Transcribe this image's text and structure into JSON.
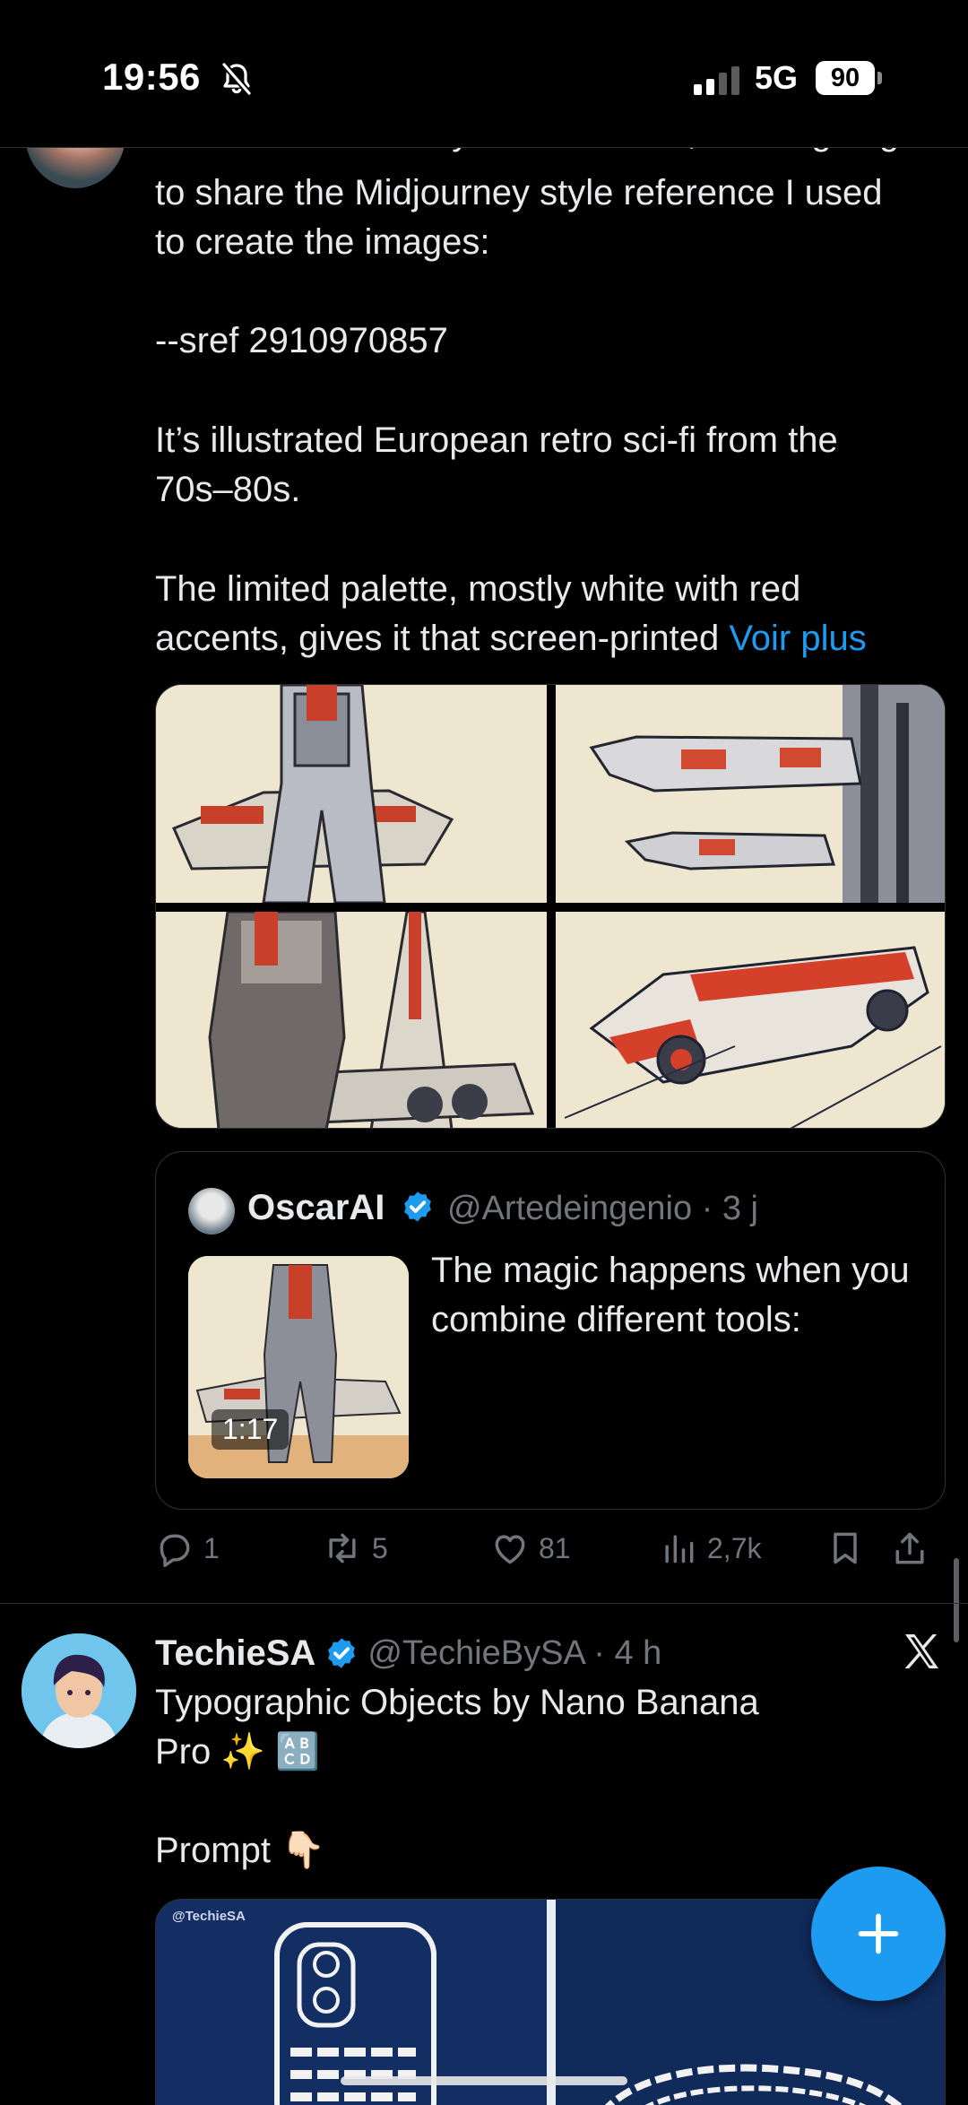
{
  "status_bar": {
    "time": "19:56",
    "network": "5G",
    "battery": "90"
  },
  "tweet1": {
    "partial_line": "This video was very well received, so I'm going",
    "lines": [
      "to share the Midjourney style reference I used",
      "to create the images:",
      "--sref 2910970857",
      "It’s illustrated European retro sci-fi from the",
      "70s–80s.",
      "The limited palette, mostly white with red",
      "accents, gives it that screen-printed"
    ],
    "more_link": "Voir plus",
    "quote": {
      "name": "OscarAI",
      "handle": "@Artedeingenio · 3 j",
      "text": "The magic happens when you combine different tools:",
      "video_duration": "1:17"
    },
    "actions": {
      "replies": "1",
      "reposts": "5",
      "likes": "81",
      "views": "2,7k"
    }
  },
  "tweet2": {
    "name": "TechieSA",
    "handle": "@TechieBySA · 4 h",
    "line1": "Typographic Objects by Nano Banana",
    "line2": "Pro ✨ 🔠",
    "prompt": "Prompt 👇🏻",
    "media_watermark": "@TechieSA"
  },
  "colors": {
    "background": "#000000",
    "text": "#e7e9ea",
    "muted": "#71767b",
    "accent": "#1d9bf0",
    "divider": "#2f3336"
  },
  "icons": [
    "bell-slash-icon",
    "verified-badge-icon",
    "reply-icon",
    "repost-icon",
    "like-icon",
    "views-icon",
    "bookmark-icon",
    "share-icon",
    "x-logo-icon",
    "plus-icon"
  ]
}
